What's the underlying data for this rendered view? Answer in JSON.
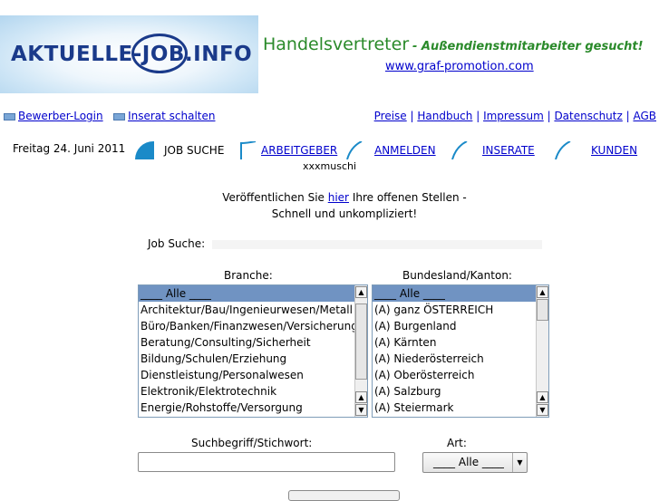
{
  "logo": {
    "text": "AKTUELLE-JOB.INFO"
  },
  "brand": {
    "title": "Handelsvertreter",
    "subtitle": "- Außendienstmitarbeiter gesucht!",
    "link": "www.graf-promotion.com"
  },
  "linkbar_left": [
    {
      "label": "Bewerber-Login"
    },
    {
      "label": "Inserat schalten"
    }
  ],
  "linkbar_right": [
    "Preise",
    "Handbuch",
    "Impressum",
    "Datenschutz",
    "AGB"
  ],
  "date": "Freitag 24. Juni 2011",
  "nav": {
    "current": "JOB SUCHE",
    "items": [
      "ARBEITGEBER",
      "ANMELDEN",
      "INSERATE",
      "KUNDEN"
    ],
    "user": "xxxmuschi",
    "accent": "#1a8ac8"
  },
  "intro": {
    "before": "Veröffentlichen Sie ",
    "link": "hier",
    "after": " Ihre offenen Stellen -",
    "line2": "Schnell und unkompliziert!"
  },
  "search": {
    "label": "Job Suche:",
    "branche": {
      "label": "Branche:",
      "options": [
        "____ Alle ____",
        "Architektur/Bau/Ingenieurwesen/Metall",
        "Büro/Banken/Finanzwesen/Versicherung",
        "Beratung/Consulting/Sicherheit",
        "Bildung/Schulen/Erziehung",
        "Dienstleistung/Personalwesen",
        "Elektronik/Elektrotechnik",
        "Energie/Rohstoffe/Versorgung"
      ]
    },
    "region": {
      "label": "Bundesland/Kanton:",
      "options": [
        "____ Alle ____",
        "(A) ganz ÖSTERREICH",
        "(A) Burgenland",
        "(A) Kärnten",
        "(A) Niederösterreich",
        "(A) Oberösterreich",
        "(A) Salzburg",
        "(A) Steiermark"
      ]
    },
    "keyword_label": "Suchbegriff/Stichwort:",
    "keyword_value": "",
    "art_label": "Art:",
    "art_value": "____ Alle ____"
  },
  "colors": {
    "link": "#0000cc",
    "brand_green": "#2a8a2a",
    "selection": "#7093c2"
  }
}
